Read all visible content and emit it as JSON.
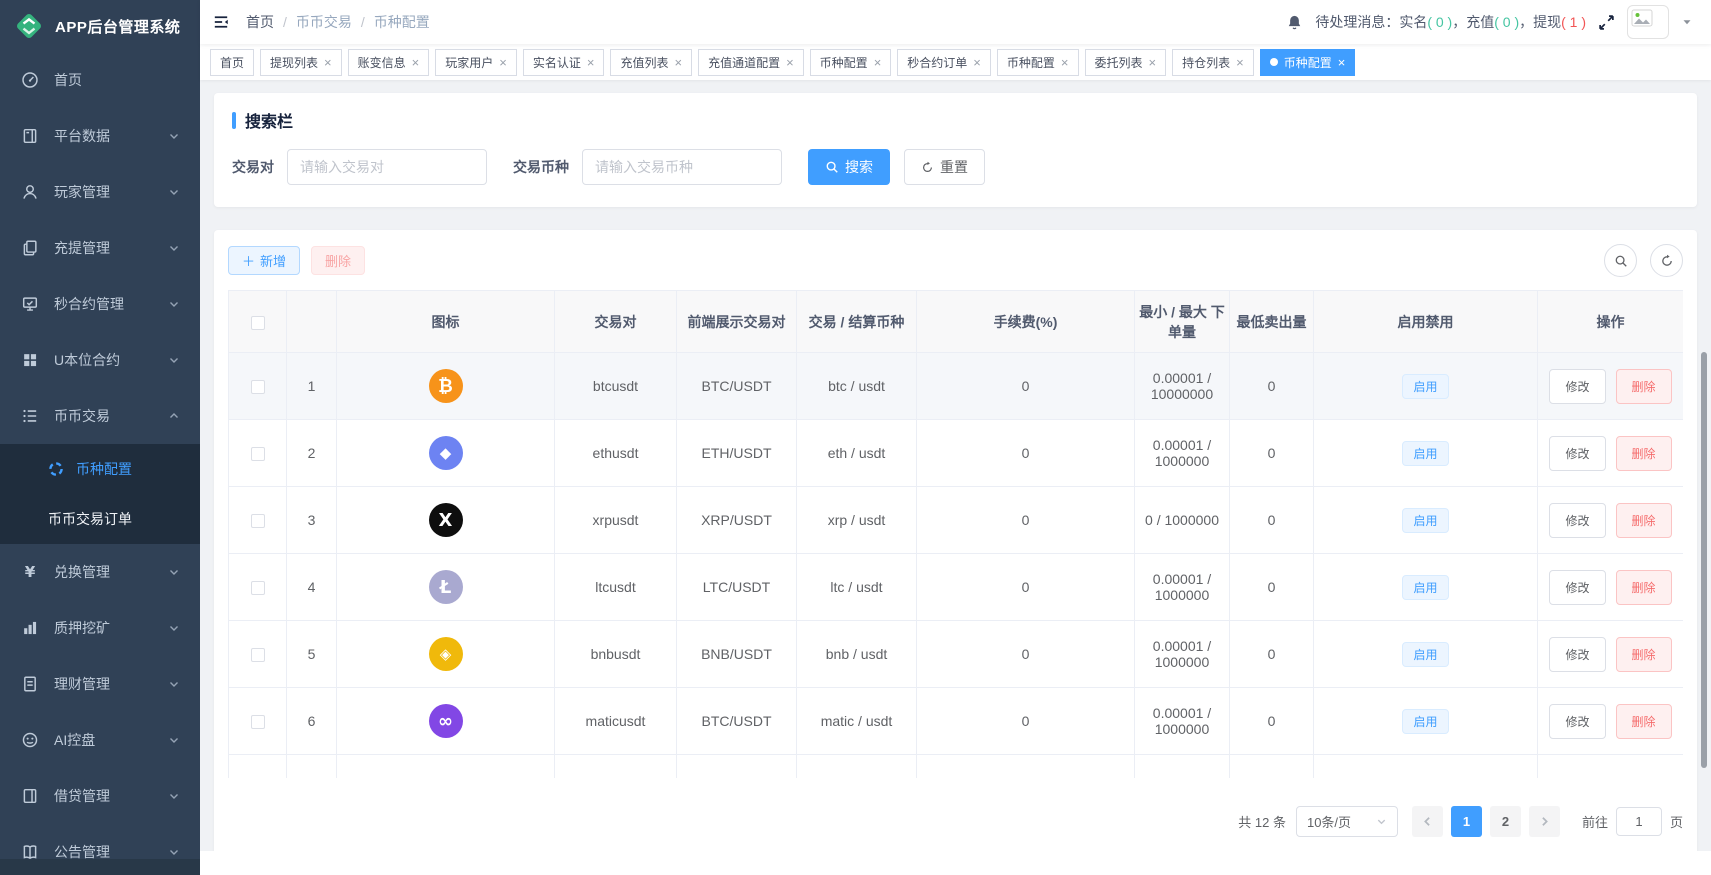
{
  "app": {
    "title": "APP后台管理系统"
  },
  "colors": {
    "accent": "#409EFF",
    "sidebar_bg": "#304156",
    "submenu_bg": "#1F2D3D",
    "teal_count": "#45C5A2",
    "red_count": "#F25555",
    "danger": "#F56C6C"
  },
  "sidebar": {
    "items": [
      {
        "id": "home",
        "label": "首页",
        "icon": "gauge-icon",
        "arrow": false
      },
      {
        "id": "platform-data",
        "label": "平台数据",
        "icon": "database-icon",
        "arrow": true
      },
      {
        "id": "player-manage",
        "label": "玩家管理",
        "icon": "user-icon",
        "arrow": true
      },
      {
        "id": "deposit-manage",
        "label": "充提管理",
        "icon": "copy-icon",
        "arrow": true
      },
      {
        "id": "seconds-contract",
        "label": "秒合约管理",
        "icon": "monitor-icon",
        "arrow": true
      },
      {
        "id": "u-contract",
        "label": "U本位合约",
        "icon": "grid-icon",
        "arrow": true
      },
      {
        "id": "spot-trade",
        "label": "币币交易",
        "icon": "list-icon",
        "arrow": true,
        "expanded": true,
        "children": [
          {
            "id": "coin-config",
            "label": "币种配置",
            "icon": "coin-icon",
            "active": true
          },
          {
            "id": "spot-orders",
            "label": "币币交易订单",
            "active": false
          }
        ]
      },
      {
        "id": "exchange-manage",
        "label": "兑换管理",
        "icon": "yen-icon",
        "arrow": true
      },
      {
        "id": "staking-mining",
        "label": "质押挖矿",
        "icon": "chart-icon",
        "arrow": true
      },
      {
        "id": "wealth-manage",
        "label": "理财管理",
        "icon": "document-icon",
        "arrow": true
      },
      {
        "id": "ai-control",
        "label": "AI控盘",
        "icon": "robot-icon",
        "arrow": true
      },
      {
        "id": "loan-manage",
        "label": "借贷管理",
        "icon": "ledger-icon",
        "arrow": true
      },
      {
        "id": "notice-manage",
        "label": "公告管理",
        "icon": "notice-icon",
        "arrow": true
      }
    ]
  },
  "header": {
    "breadcrumb": [
      "首页",
      "币币交易",
      "币种配置"
    ],
    "pending_label": "待处理消息：",
    "pending": [
      {
        "name": "实名",
        "count": "0",
        "color": "teal",
        "sep": "，"
      },
      {
        "name": "充值",
        "count": "0",
        "color": "teal",
        "sep": "，"
      },
      {
        "name": "提现",
        "count": "1",
        "color": "red",
        "sep": ""
      }
    ]
  },
  "tabs": [
    {
      "label": "首页",
      "closable": false,
      "active": false
    },
    {
      "label": "提现列表",
      "closable": true,
      "active": false
    },
    {
      "label": "账变信息",
      "closable": true,
      "active": false
    },
    {
      "label": "玩家用户",
      "closable": true,
      "active": false
    },
    {
      "label": "实名认证",
      "closable": true,
      "active": false
    },
    {
      "label": "充值列表",
      "closable": true,
      "active": false
    },
    {
      "label": "充值通道配置",
      "closable": true,
      "active": false
    },
    {
      "label": "币种配置",
      "closable": true,
      "active": false
    },
    {
      "label": "秒合约订单",
      "closable": true,
      "active": false
    },
    {
      "label": "币种配置",
      "closable": true,
      "active": false
    },
    {
      "label": "委托列表",
      "closable": true,
      "active": false
    },
    {
      "label": "持仓列表",
      "closable": true,
      "active": false
    },
    {
      "label": "币种配置",
      "closable": true,
      "active": true
    }
  ],
  "search": {
    "title": "搜索栏",
    "fields": [
      {
        "label": "交易对",
        "placeholder": "请输入交易对",
        "value": ""
      },
      {
        "label": "交易币种",
        "placeholder": "请输入交易币种",
        "value": ""
      }
    ],
    "search_label": "搜索",
    "reset_label": "重置"
  },
  "toolbar": {
    "add_label": "新增",
    "delete_label": "删除"
  },
  "table": {
    "headers": [
      "图标",
      "交易对",
      "前端展示交易对",
      "交易 / 结算币种",
      "手续费(%)",
      "最小 / 最大 下单量",
      "最低卖出量",
      "启用禁用",
      "操作"
    ],
    "enable_label": "启用",
    "row_actions": {
      "edit": "修改",
      "delete": "删除"
    },
    "coins": {
      "btc": {
        "color": "#F7931A",
        "glyph": "₿"
      },
      "eth": {
        "color": "#6D83F2",
        "glyph": "◆"
      },
      "xrp": {
        "color": "#0E0E0E",
        "glyph": "X"
      },
      "ltc": {
        "color": "#A9A9D0",
        "glyph": "Ł"
      },
      "bnb": {
        "color": "#F0B90B",
        "glyph": "◈"
      },
      "matic": {
        "color": "#8247E5",
        "glyph": "∞"
      }
    },
    "rows": [
      {
        "index": "1",
        "coin": "btc",
        "pair": "btcusdt",
        "display_pair": "BTC/USDT",
        "settle_pair": "btc / usdt",
        "fee": "0",
        "min_max": "0.00001 / 10000000",
        "min_sell": "0"
      },
      {
        "index": "2",
        "coin": "eth",
        "pair": "ethusdt",
        "display_pair": "ETH/USDT",
        "settle_pair": "eth / usdt",
        "fee": "0",
        "min_max": "0.00001 / 1000000",
        "min_sell": "0"
      },
      {
        "index": "3",
        "coin": "xrp",
        "pair": "xrpusdt",
        "display_pair": "XRP/USDT",
        "settle_pair": "xrp / usdt",
        "fee": "0",
        "min_max": "0 / 1000000",
        "min_sell": "0"
      },
      {
        "index": "4",
        "coin": "ltc",
        "pair": "ltcusdt",
        "display_pair": "LTC/USDT",
        "settle_pair": "ltc / usdt",
        "fee": "0",
        "min_max": "0.00001 / 1000000",
        "min_sell": "0"
      },
      {
        "index": "5",
        "coin": "bnb",
        "pair": "bnbusdt",
        "display_pair": "BNB/USDT",
        "settle_pair": "bnb / usdt",
        "fee": "0",
        "min_max": "0.00001 / 1000000",
        "min_sell": "0"
      },
      {
        "index": "6",
        "coin": "matic",
        "pair": "maticusdt",
        "display_pair": "BTC/USDT",
        "settle_pair": "matic / usdt",
        "fee": "0",
        "min_max": "0.00001 / 1000000",
        "min_sell": "0"
      }
    ]
  },
  "pagination": {
    "total": "共 12 条",
    "page_size": "10条/页",
    "pages": [
      "1",
      "2"
    ],
    "active_page": "1",
    "goto_label": "前往",
    "goto_value": "1",
    "page_label": "页"
  }
}
